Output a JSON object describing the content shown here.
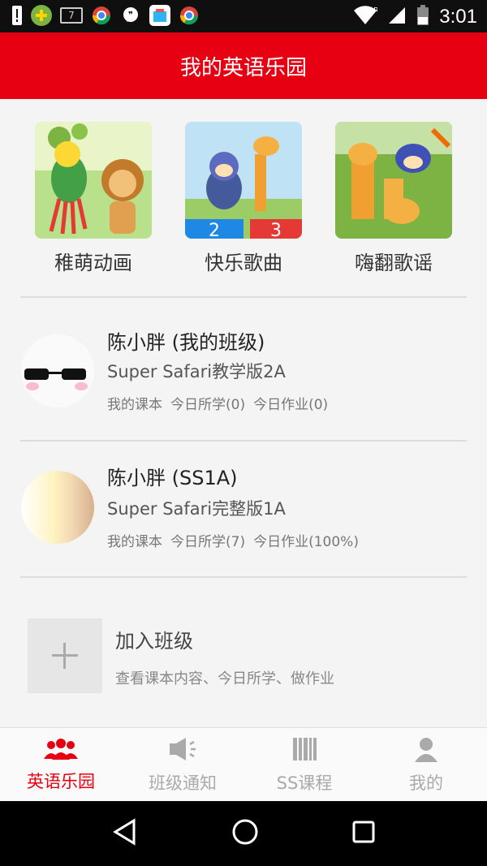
{
  "status_bar": {
    "time": "3:01",
    "calendar_day": "7"
  },
  "header": {
    "title": "我的英语乐园"
  },
  "categories": [
    {
      "label": "稚萌动画"
    },
    {
      "label": "快乐歌曲"
    },
    {
      "label": "嗨翻歌谣"
    }
  ],
  "classes": [
    {
      "name": "陈小胖 (我的班级)",
      "course": "Super Safari教学版2A",
      "meta": [
        "我的课本",
        "今日所学(0)",
        "今日作业(0)"
      ]
    },
    {
      "name": "陈小胖 (SS1A)",
      "course": "Super Safari完整版1A",
      "meta": [
        "我的课本",
        "今日所学(7)",
        "今日作业(100%)"
      ]
    }
  ],
  "join": {
    "title": "加入班级",
    "subtitle": "查看课本内容、今日所学、做作业"
  },
  "tabs": [
    {
      "label": "英语乐园",
      "icon": "users-icon",
      "active": true
    },
    {
      "label": "班级通知",
      "icon": "speaker-icon",
      "active": false
    },
    {
      "label": "SS课程",
      "icon": "books-icon",
      "active": false
    },
    {
      "label": "我的",
      "icon": "person-icon",
      "active": false
    }
  ],
  "colors": {
    "accent": "#e60012",
    "inactive_tab": "#aaaaaa"
  }
}
